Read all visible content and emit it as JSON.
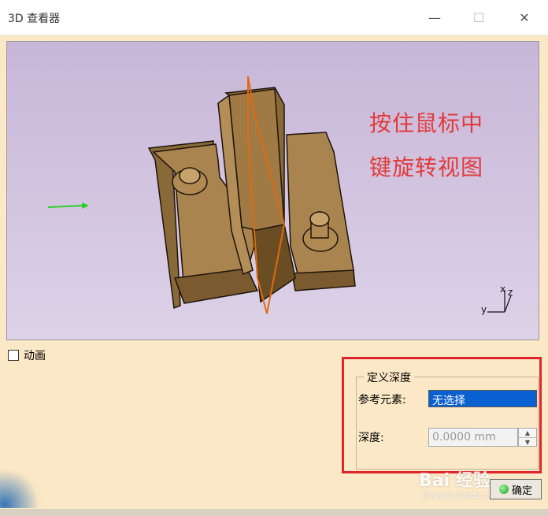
{
  "window": {
    "title": "3D 查看器",
    "minimize_glyph": "—",
    "maximize_glyph": "☐",
    "close_glyph": "✕"
  },
  "viewer": {
    "annotation_line1": "按住鼠标中",
    "annotation_line2": "键旋转视图",
    "axis_x": "x",
    "axis_y": "y",
    "axis_z": "z",
    "model_color": "#9c7a45",
    "plane_color": "#e06a10",
    "arrow_color": "#2ad12a"
  },
  "animation": {
    "label": "动画",
    "checked": false
  },
  "depth_group": {
    "legend": "定义深度",
    "ref_label": "参考元素:",
    "ref_value": "无选择",
    "depth_label": "深度:",
    "depth_value": "0.0000 mm"
  },
  "ok_button": {
    "label": "确定"
  },
  "watermark": {
    "main": "Bai 经验",
    "sub": "jingyan.baidu.com"
  }
}
